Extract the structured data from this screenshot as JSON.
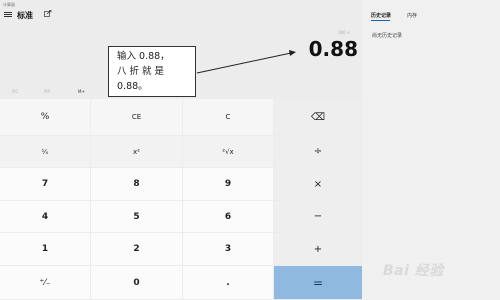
{
  "window": {
    "title": "计算器",
    "minimize_icon": "minimize-icon",
    "maximize_icon": "maximize-icon",
    "close_icon": "close-icon"
  },
  "header": {
    "menu_icon": "hamburger-menu-icon",
    "mode": "标准",
    "keep_on_top_icon": "keep-on-top-icon"
  },
  "panel": {
    "tabs": [
      "历史记录",
      "内存"
    ],
    "active_tab": "历史记录",
    "empty_text": "尚无历史记录"
  },
  "display": {
    "expression": "100 ×",
    "value": "0.88"
  },
  "memory_row": {
    "items": [
      "MC",
      "MR",
      "M+"
    ]
  },
  "callout": {
    "lines": [
      "输入 0.88，",
      "八 折 就 是",
      "0.88。"
    ]
  },
  "keys": {
    "percent": "%",
    "ce": "CE",
    "c": "C",
    "backspace": "⌫",
    "reciprocal": "¹⁄ₓ",
    "square": "x²",
    "sqrt": "²√x",
    "divide": "÷",
    "k7": "7",
    "k8": "8",
    "k9": "9",
    "multiply": "×",
    "k4": "4",
    "k5": "5",
    "k6": "6",
    "minus": "−",
    "k1": "1",
    "k2": "2",
    "k3": "3",
    "plus": "+",
    "negate": "⁺⁄₋",
    "k0": "0",
    "decimal": ".",
    "equals": "="
  },
  "watermark": "Bai 经验",
  "colors": {
    "accent": "#1f5fb5",
    "equals_bg": "#8fb9df"
  }
}
